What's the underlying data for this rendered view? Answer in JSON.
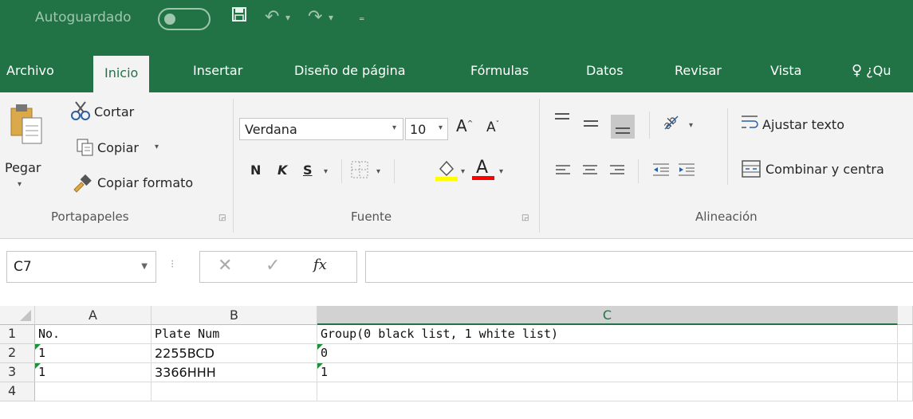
{
  "titlebar": {
    "autosave_label": "Autoguardado",
    "autosave_state": "off",
    "icons": [
      "save-icon",
      "undo-icon",
      "redo-icon",
      "customize-qat-icon"
    ]
  },
  "tabs": [
    {
      "label": "Archivo"
    },
    {
      "label": "Inicio",
      "active": true
    },
    {
      "label": "Insertar"
    },
    {
      "label": "Diseño de página"
    },
    {
      "label": "Fórmulas"
    },
    {
      "label": "Datos"
    },
    {
      "label": "Revisar"
    },
    {
      "label": "Vista"
    },
    {
      "label": "¿Qu"
    }
  ],
  "clipboard": {
    "paste": "Pegar",
    "cut": "Cortar",
    "copy": "Copiar",
    "format_painter": "Copiar formato",
    "group_label": "Portapapeles"
  },
  "font": {
    "name": "Verdana",
    "size": "10",
    "bold": "N",
    "italic": "K",
    "underline": "S",
    "group_label": "Fuente",
    "highlight_color": "#ffff00",
    "font_color": "#ff0000"
  },
  "alignment": {
    "wrap_text": "Ajustar texto",
    "merge_center": "Combinar y centra",
    "group_label": "Alineación"
  },
  "formula_bar": {
    "name_box": "C7",
    "fx": "fx",
    "formula": ""
  },
  "grid": {
    "columns": [
      "A",
      "B",
      "C"
    ],
    "selected_column": "C",
    "rows": [
      {
        "num": "1",
        "cells": [
          "No.",
          "Plate Num",
          "Group(0 black list, 1 white list)"
        ]
      },
      {
        "num": "2",
        "cells": [
          "1",
          "2255BCD",
          "0"
        ]
      },
      {
        "num": "3",
        "cells": [
          "1",
          "3366HHH",
          "1"
        ]
      },
      {
        "num": "4",
        "cells": [
          "",
          "",
          ""
        ]
      }
    ]
  },
  "colors": {
    "excel_green": "#217346",
    "ribbon_bg": "#f3f3f3",
    "error_indicator": "#1f8f3a"
  }
}
